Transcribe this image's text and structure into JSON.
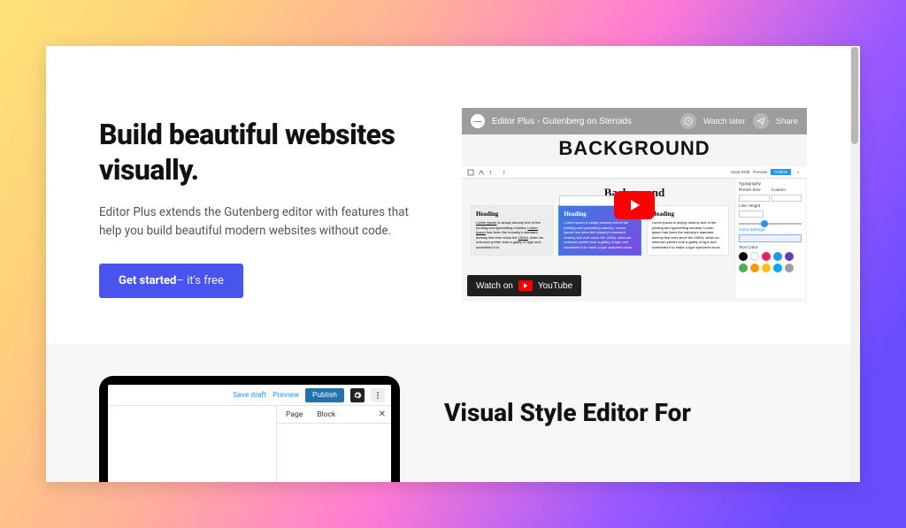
{
  "hero": {
    "title": "Build beautiful websites visually.",
    "desc": "Editor Plus extends the Gutenberg editor with features that help you build beautiful modern websites without code.",
    "cta_bold": "Get started",
    "cta_light": "– it's free"
  },
  "video": {
    "title": "Editor Plus - Gutenberg on Steroids",
    "watch_later": "Watch later",
    "share": "Share",
    "watch_on": "Watch on",
    "platform": "YouTube",
    "content": {
      "bg_large": "BACKGROUND",
      "bg_small": "Background",
      "toolbar": {
        "save": "Save Draft",
        "preview": "Preview",
        "publish": "Publish"
      },
      "col_heading": "Heading",
      "lorem": "Lorem Ipsum is simply dummy text of the printing and typesetting industry. Lorem Ipsum has been the industry's standard dummy text ever since the 1500s, when an unknown printer took a galley of type and scrambled it to make a type specimen book.",
      "sidebar": {
        "typography": "Typography",
        "preset": "Preset Size",
        "custom": "Custom",
        "line_height": "Line Height",
        "color": "Color settings",
        "text_color": "Text Color"
      },
      "swatches": [
        "#000000",
        "#ffffff",
        "#e91e63",
        "#2196f3",
        "#673ab7",
        "#4caf50",
        "#ff9800",
        "#ffc107",
        "#03a9f4",
        "#9e9e9e"
      ]
    }
  },
  "sec2": {
    "title": "Visual Style Editor For",
    "wp": {
      "save_draft": "Save draft",
      "preview": "Preview",
      "publish": "Publish",
      "tab_page": "Page",
      "tab_block": "Block"
    }
  }
}
